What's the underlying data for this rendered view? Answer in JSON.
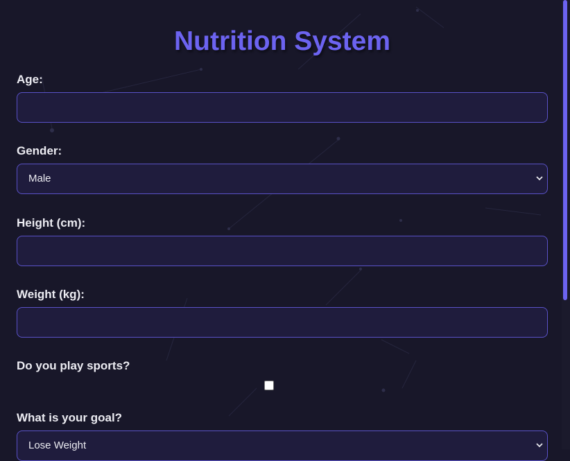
{
  "title": "Nutrition System",
  "fields": {
    "age": {
      "label": "Age:",
      "value": ""
    },
    "gender": {
      "label": "Gender:",
      "value": "Male"
    },
    "height": {
      "label": "Height (cm):",
      "value": ""
    },
    "weight": {
      "label": "Weight (kg):",
      "value": ""
    },
    "sports": {
      "label": "Do you play sports?",
      "checked": false
    },
    "goal": {
      "label": "What is your goal?",
      "value": "Lose Weight"
    }
  },
  "icons": {
    "dropdown": "chevron-down-icon"
  },
  "colors": {
    "accent": "#6c63f0",
    "background": "#181729",
    "field_bg": "#1f1c3d",
    "field_border": "#5a52c8"
  }
}
